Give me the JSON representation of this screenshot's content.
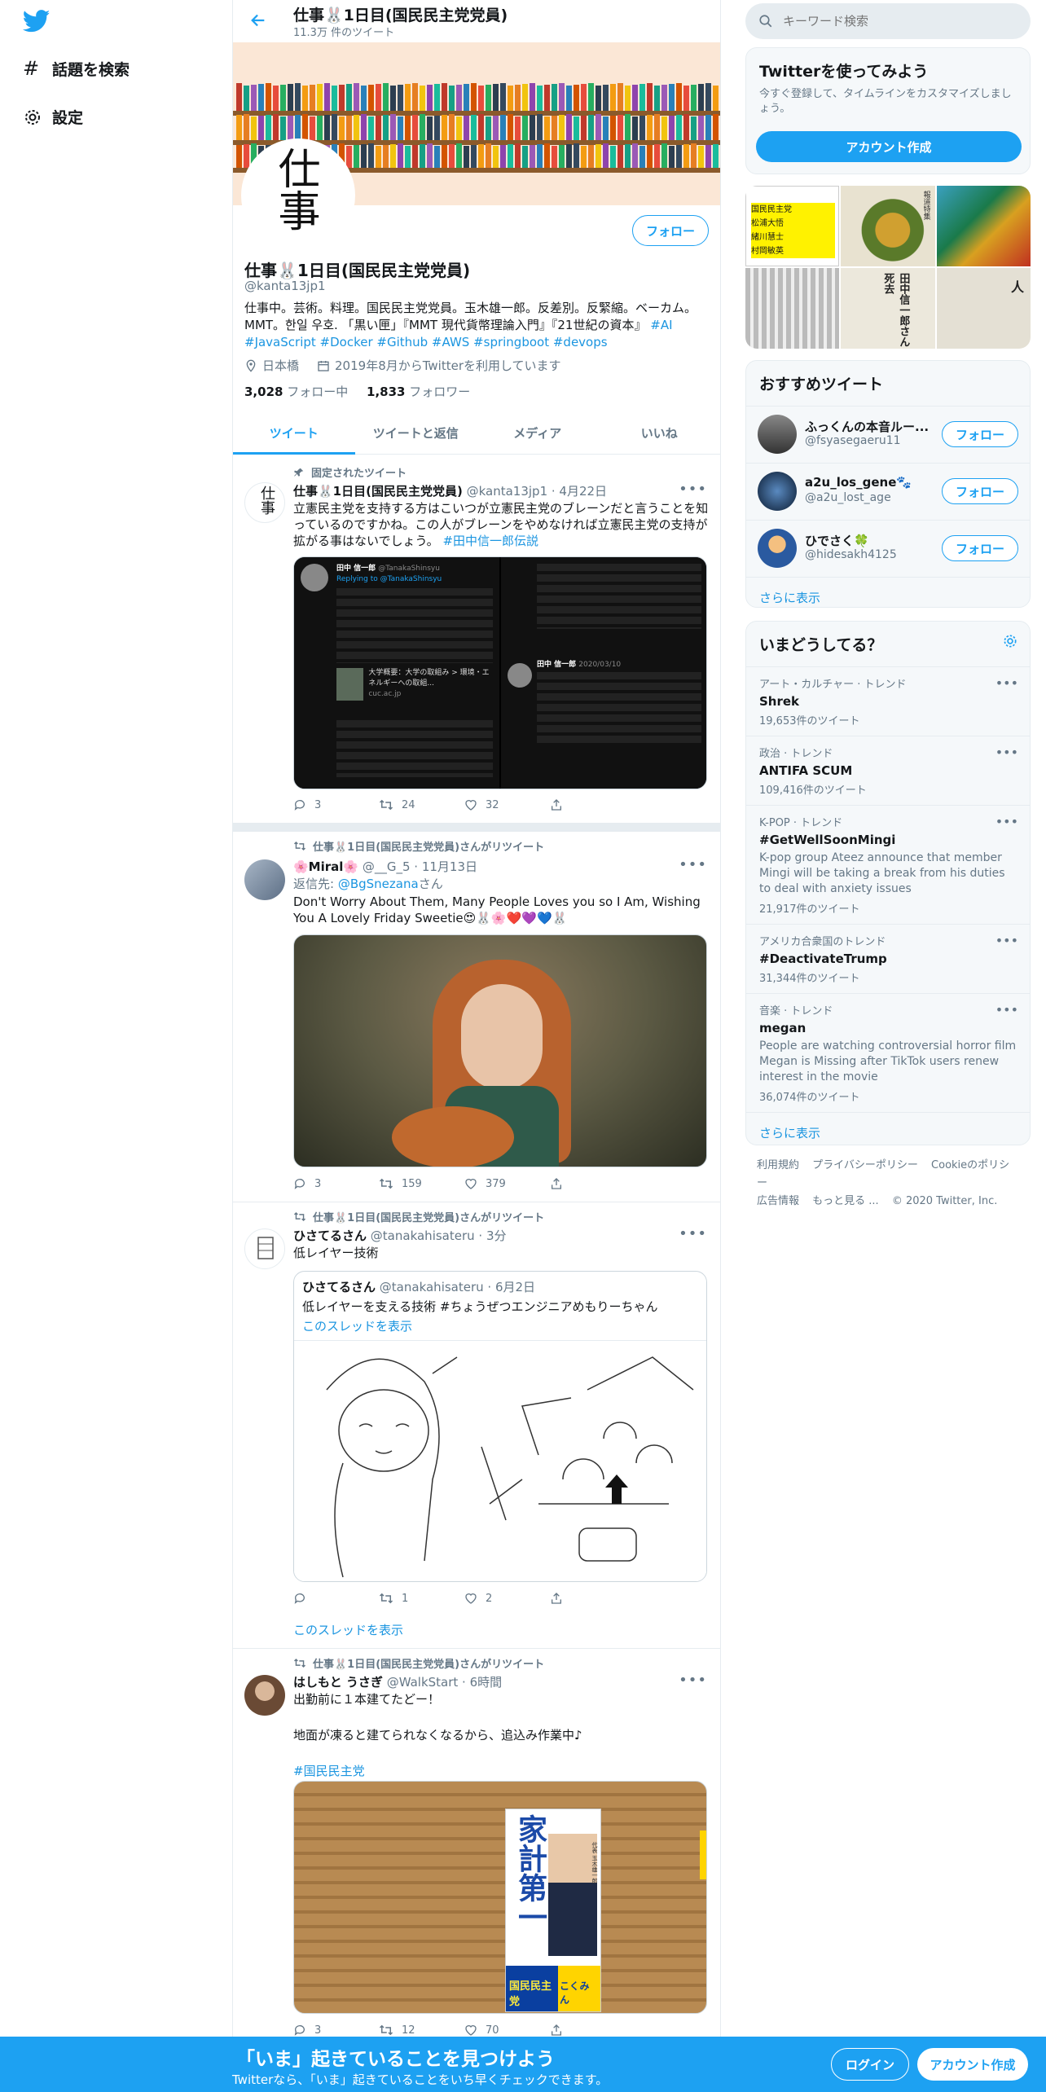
{
  "nav": {
    "explore": "話題を検索",
    "settings": "設定"
  },
  "header": {
    "name": "仕事🐰1日目(国民民主党党員)",
    "tweet_count": "11.3万 件のツイート"
  },
  "profile": {
    "avatar_text": "仕事",
    "follow_label": "フォロー",
    "name": "仕事🐰1日目(国民民主党党員)",
    "handle": "@kanta13jp1",
    "bio": "仕事中。芸術。料理。国民民主党党員。玉木雄一郎。反差別。反緊縮。ベーカム。MMT。한일 우호. 「黒い匣」『MMT 現代貨幣理論入門』『21世紀の資本』",
    "bio_tags": "#AI #JavaScript #Docker #Github #AWS #springboot #devops",
    "location": "日本橋",
    "joined": "2019年8月からTwitterを利用しています",
    "following_count": "3,028",
    "following_label": "フォロー中",
    "followers_count": "1,833",
    "followers_label": "フォロワー"
  },
  "tabs": [
    "ツイート",
    "ツイートと返信",
    "メディア",
    "いいね"
  ],
  "tweets": {
    "t1": {
      "pinned": "固定されたツイート",
      "name": "仕事🐰1日目(国民民主党党員)",
      "handle_time": "@kanta13jp1 · 4月22日",
      "text": "立憲民主党を支持する方はこいつが立憲民主党のブレーンだと言うことを知っているのですかね。この人がブレーンをやめなければ立憲民主党の支持が拡がる事はないでしょう。",
      "tag": "#田中信一郎伝説",
      "reply": "3",
      "retweet": "24",
      "like": "32",
      "media_author": "田中 信一郎",
      "media_handle": "@TanakaShinsyu",
      "media_replying": "Replying to @TanakaShinsyu",
      "media_date": "2020/03/10",
      "media_link_title": "大学概要：大学の取組み > 環境・エネルギーへの取組...",
      "media_link_domain": "cuc.ac.jp"
    },
    "t2": {
      "retweeted": "仕事🐰1日目(国民民主党党員)さんがリツイート",
      "name": "🌸Miral🌸",
      "handle_time": "@__G_5 · 11月13日",
      "reply_to_label": "返信先:",
      "reply_to": "@BgSnezana",
      "reply_to_suffix": "さん",
      "text": "Don't Worry About Them, Many People Loves you so I Am, Wishing You A Lovely Friday Sweetie😍🐰🌸❤️💜💙🐰",
      "reply": "3",
      "retweet": "159",
      "like": "379"
    },
    "t3": {
      "retweeted": "仕事🐰1日目(国民民主党党員)さんがリツイート",
      "name": "ひさてるさん",
      "handle_time": "@tanakahisateru · 3分",
      "text": "低レイヤー技術",
      "quote_name": "ひさてるさん",
      "quote_handle_time": "@tanakahisateru · 6月2日",
      "quote_text": "低レイヤーを支える技術 #ちょうぜつエンジニアめもりーちゃん",
      "quote_thread": "このスレッドを表示",
      "reply": "",
      "retweet": "1",
      "like": "2",
      "show_thread": "このスレッドを表示"
    },
    "t4": {
      "retweeted": "仕事🐰1日目(国民民主党党員)さんがリツイート",
      "name": "はしもと うさぎ",
      "handle_time": "@WalkStart · 6時間",
      "text1": "出勤前に１本建てたどー！",
      "text2": "地面が凍ると建てられなくなるから、追込み作業中♪",
      "tag": "#国民民主党",
      "poster_text": "家計第一",
      "poster_party": "国民民主党",
      "poster_name": "こくみん",
      "poster_person": "代表 玉木雄一郎",
      "reply": "3",
      "retweet": "12",
      "like": "70"
    }
  },
  "right": {
    "search_placeholder": "キーワード検索",
    "signup_title": "Twitterを使ってみよう",
    "signup_sub": "今すぐ登録して、タイムラインをカスタマイズしましょう。",
    "signup_button": "アカウント作成",
    "media_grid": {
      "tile1_labels": [
        "国民民主党",
        "松浦大悟",
        "緒川慧士",
        "村岡敏英"
      ],
      "tile2_text": "報道特集",
      "tile5_text": "田中信一郎さん死去",
      "tile6_text": "人"
    },
    "recommended_title": "おすすめツイート",
    "recommended": [
      {
        "name": "ふっくんの本音ルー...",
        "handle": "@fsyasegaeru11",
        "follow": "フォロー"
      },
      {
        "name": "a2u_los_gene🐾",
        "handle": "@a2u_lost_age",
        "follow": "フォロー"
      },
      {
        "name": "ひでさく🍀",
        "handle": "@hidesakh4125",
        "follow": "フォロー"
      }
    ],
    "recommended_more": "さらに表示",
    "trends_title": "いまどうしてる？",
    "trends": [
      {
        "context": "アート・カルチャー · トレンド",
        "name": "Shrek",
        "desc": "",
        "count": "19,653件のツイート"
      },
      {
        "context": "政治 · トレンド",
        "name": "ANTIFA SCUM",
        "desc": "",
        "count": "109,416件のツイート"
      },
      {
        "context": "K-POP · トレンド",
        "name": "#GetWellSoonMingi",
        "desc": "K-pop group Ateez announce that member Mingi will be taking a break from his duties to deal with anxiety issues",
        "count": "21,917件のツイート"
      },
      {
        "context": "アメリカ合衆国のトレンド",
        "name": "#DeactivateTrump",
        "desc": "",
        "count": "31,344件のツイート"
      },
      {
        "context": "音楽 · トレンド",
        "name": "megan",
        "desc": "People are watching controversial horror film Megan is Missing after TikTok users renew interest in the movie",
        "count": "36,074件のツイート"
      }
    ],
    "trends_more": "さらに表示",
    "footer": [
      "利用規約",
      "プライバシーポリシー",
      "Cookieのポリシー",
      "広告情報",
      "もっと見る ...",
      "© 2020 Twitter, Inc."
    ]
  },
  "bottom": {
    "headline": "「いま」起きていることを見つけよう",
    "sub": "Twitterなら、「いま」起きていることをいち早くチェックできます。",
    "login": "ログイン",
    "signup": "アカウント作成"
  },
  "colors": {
    "accent": "#1da1f2",
    "link": "#1b95e0",
    "border": "#e6ecf0",
    "secondary_text": "#657786"
  }
}
